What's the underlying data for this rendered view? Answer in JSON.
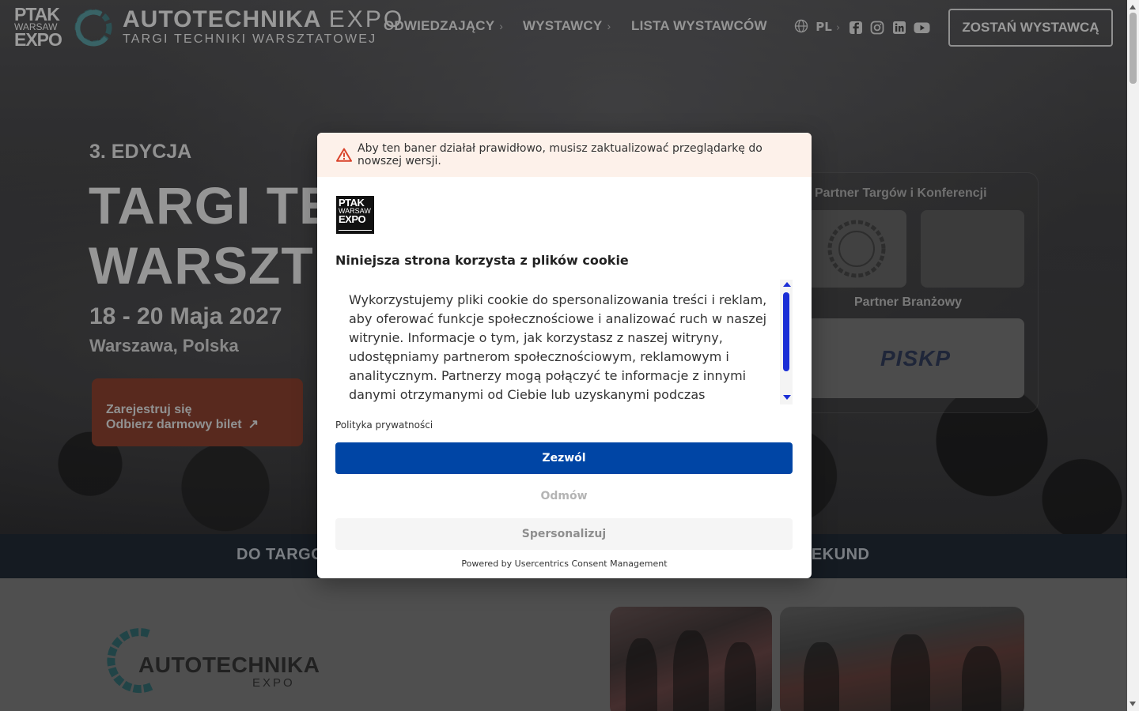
{
  "header": {
    "brand": {
      "line1": "PTAK",
      "line2": "WARSAW",
      "line3": "EXPO"
    },
    "event_logo": {
      "word1": "AUTOTECHNIKA",
      "word2": "EXPO",
      "tagline": "TARGI TECHNIKI WARSZTATOWEJ"
    },
    "nav": [
      {
        "label": "ODWIEDZAJĄCY",
        "has_submenu": true
      },
      {
        "label": "WYSTAWCY",
        "has_submenu": true
      },
      {
        "label": "LISTA WYSTAWCÓW",
        "has_submenu": false
      }
    ],
    "language": "PL",
    "social_icons": [
      "facebook-icon",
      "instagram-icon",
      "linkedin-icon",
      "youtube-icon"
    ],
    "cta_label": "ZOSTAŃ WYSTAWCĄ"
  },
  "hero": {
    "edition": "3. EDYCJA",
    "headline_line1": "TARGI TE",
    "headline_line2": "WARSZT",
    "dates": "18 - 20 Maja 2027",
    "city": "Warszawa, Polska",
    "register_line1": "Zarejestruj się",
    "register_line2": "Odbierz darmowy bilet",
    "arrow_glyph": "↗"
  },
  "partners": {
    "heading1": "Partner Targów i Konferencji",
    "heading2": "Partner Branżowy",
    "logo_text": "PISKP"
  },
  "countdown": {
    "left_text": "DO TARGO",
    "right_text": "SEKUND"
  },
  "lower": {
    "logo_word1": "AUTOTECHNIKA",
    "logo_word2": "EXPO"
  },
  "consent": {
    "warning": "Aby ten baner działał prawidłowo, musisz zaktualizować przeglądarkę do nowszej wersji.",
    "logo": {
      "line1": "PTAK",
      "line2": "WARSAW",
      "line3": "EXPO"
    },
    "title": "Niniejsza strona korzysta z plików cookie",
    "body": "Wykorzystujemy pliki cookie do spersonalizowania treści i reklam, aby oferować funkcje społecznościowe i analizować ruch w naszej witrynie. Informacje o tym, jak korzystasz z naszej witryny, udostępniamy partnerom społecznościowym, reklamowym i analitycznym. Partnerzy mogą połączyć te informacje z innymi danymi otrzymanymi od Ciebie lub uzyskanymi podczas",
    "privacy_link": "Polityka prywatności",
    "allow_label": "Zezwól",
    "deny_label": "Odmów",
    "customize_label": "Spersonalizuj",
    "powered_by": "Powered by Usercentrics Consent Management",
    "colors": {
      "primary": "#0045a5",
      "scroll_accent": "#1a2ed6",
      "warning_bg": "#fdf1ea",
      "warning_icon": "#d9432b"
    }
  }
}
